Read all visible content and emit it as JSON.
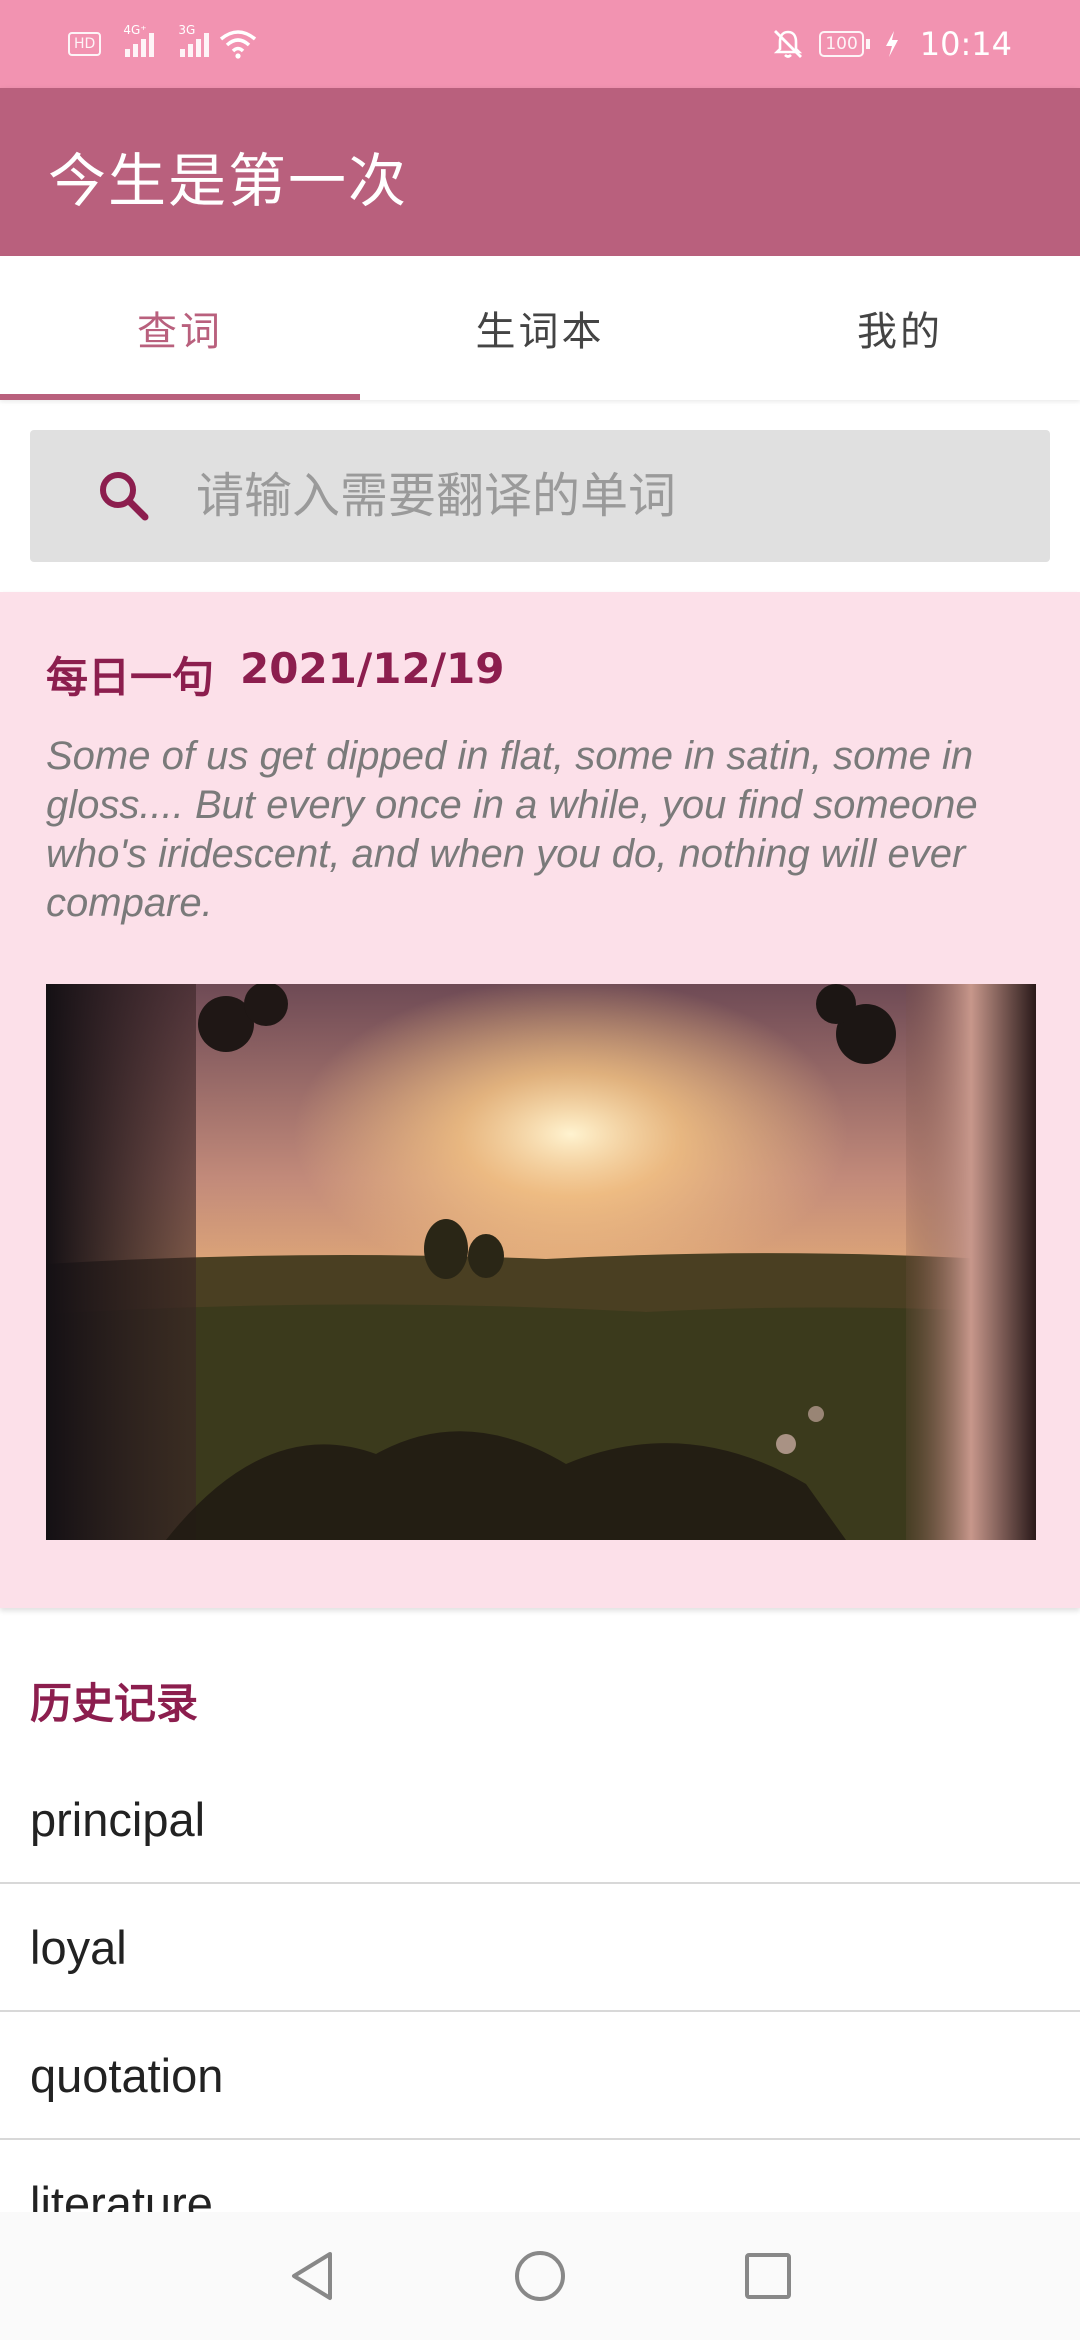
{
  "status_bar": {
    "hd_label": "HD",
    "sim1_tag": "4G⁺",
    "sim2_tag": "3G",
    "battery": "100",
    "time": "10:14"
  },
  "app_bar": {
    "title": "今生是第一次"
  },
  "tabs": [
    {
      "label": "查词",
      "active": true
    },
    {
      "label": "生词本",
      "active": false
    },
    {
      "label": "我的",
      "active": false
    }
  ],
  "search": {
    "placeholder": "请输入需要翻译的单词",
    "value": ""
  },
  "daily": {
    "label": "每日一句",
    "date": "2021/12/19",
    "quote": "Some of us get dipped in flat, some in satin, some in gloss.... But every once in a while, you find someone who's iridescent, and when you do, nothing will ever compare."
  },
  "history": {
    "title": "历史记录",
    "items": [
      "principal",
      "loyal",
      "quotation",
      "literature"
    ]
  },
  "colors": {
    "status_bar": "#f293b1",
    "app_bar": "#b9607d",
    "accent_text": "#8c1e4e",
    "card_bg": "#fce0e9"
  },
  "icons": {
    "search": "search-icon",
    "nav_back": "back-icon",
    "nav_home": "home-icon",
    "nav_recent": "recent-apps-icon"
  }
}
